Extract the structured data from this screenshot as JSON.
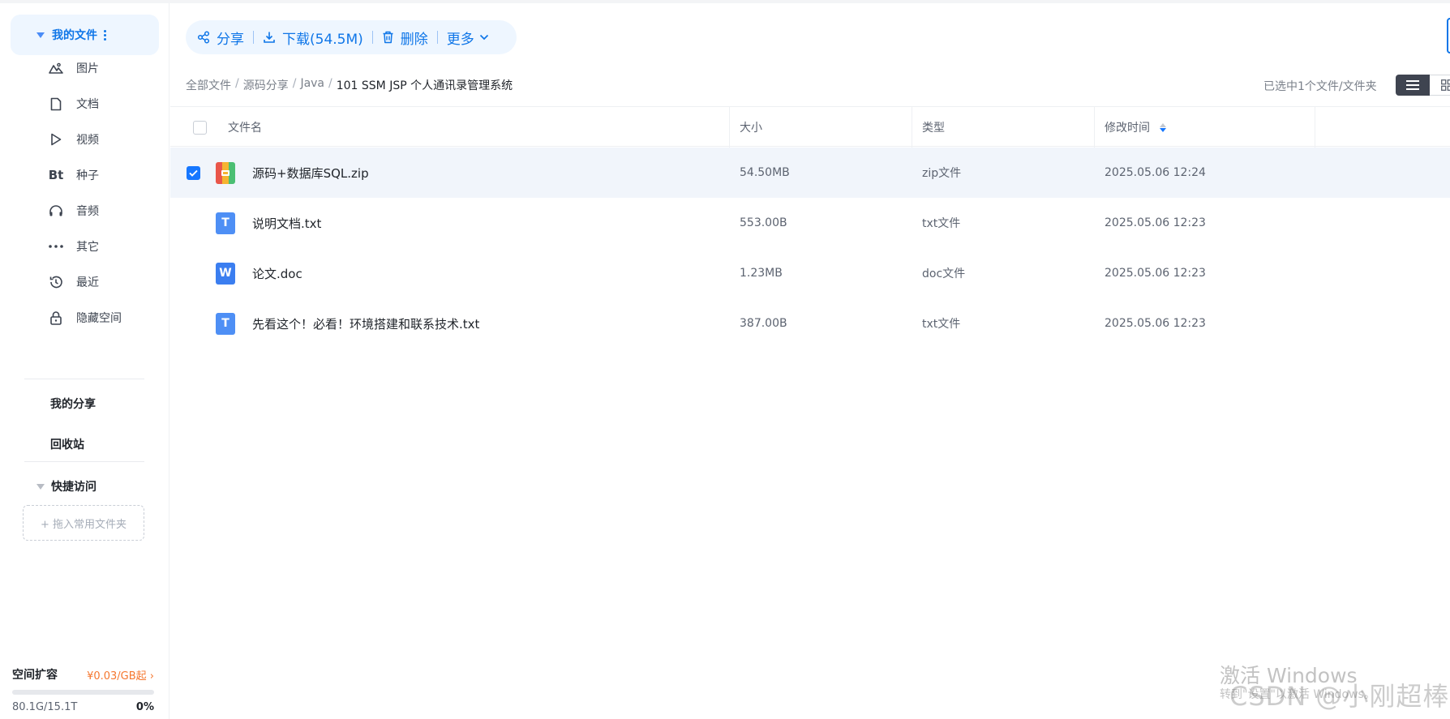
{
  "sidebar": {
    "my_files": "我的文件",
    "items": [
      {
        "label": "图片",
        "icon": "image-icon"
      },
      {
        "label": "文档",
        "icon": "document-icon"
      },
      {
        "label": "视频",
        "icon": "video-icon"
      },
      {
        "label": "种子",
        "icon": "bt-icon"
      },
      {
        "label": "音频",
        "icon": "headphones-icon"
      },
      {
        "label": "其它",
        "icon": "more-dots-icon"
      },
      {
        "label": "最近",
        "icon": "history-icon"
      },
      {
        "label": "隐藏空间",
        "icon": "lock-icon"
      }
    ],
    "bt_text": "Bt",
    "my_share": "我的分享",
    "recycle_bin": "回收站",
    "quick_access": "快捷访问",
    "drop_placeholder": "+ 拖入常用文件夹",
    "space": {
      "title": "空间扩容",
      "price": "¥0.03/GB起",
      "usage": "80.1G/15.1T",
      "percent": "0%",
      "fraction_used": 0.0
    }
  },
  "toolbar": {
    "share": "分享",
    "download": "下载(54.5M)",
    "delete": "删除",
    "more": "更多"
  },
  "breadcrumb": {
    "items": [
      "全部文件",
      "源码分享",
      "Java"
    ],
    "current": "101 SSM JSP 个人通讯录管理系统"
  },
  "selection_status": "已选中1个文件/文件夹",
  "table": {
    "headers": {
      "name": "文件名",
      "size": "大小",
      "type": "类型",
      "modified": "修改时间"
    },
    "rows": [
      {
        "name": "源码+数据库SQL.zip",
        "size": "54.50MB",
        "type": "zip文件",
        "modified": "2025.05.06 12:24",
        "selected": true,
        "icon_text": ""
      },
      {
        "name": "说明文档.txt",
        "size": "553.00B",
        "type": "txt文件",
        "modified": "2025.05.06 12:23",
        "selected": false,
        "icon_text": "T"
      },
      {
        "name": "论文.doc",
        "size": "1.23MB",
        "type": "doc文件",
        "modified": "2025.05.06 12:23",
        "selected": false,
        "icon_text": "W"
      },
      {
        "name": "先看这个！必看！环境搭建和联系技术.txt",
        "size": "387.00B",
        "type": "txt文件",
        "modified": "2025.05.06 12:23",
        "selected": false,
        "icon_text": "T"
      }
    ]
  },
  "watermark": {
    "windows_title": "激活 Windows",
    "windows_sub": "转到\"设置\"以激活 Windows。",
    "csdn": "CSDN @小刚超棒"
  },
  "colors": {
    "accent": "#0f76e8",
    "price": "#f5772f",
    "selected_row": "#f1f5fb"
  }
}
